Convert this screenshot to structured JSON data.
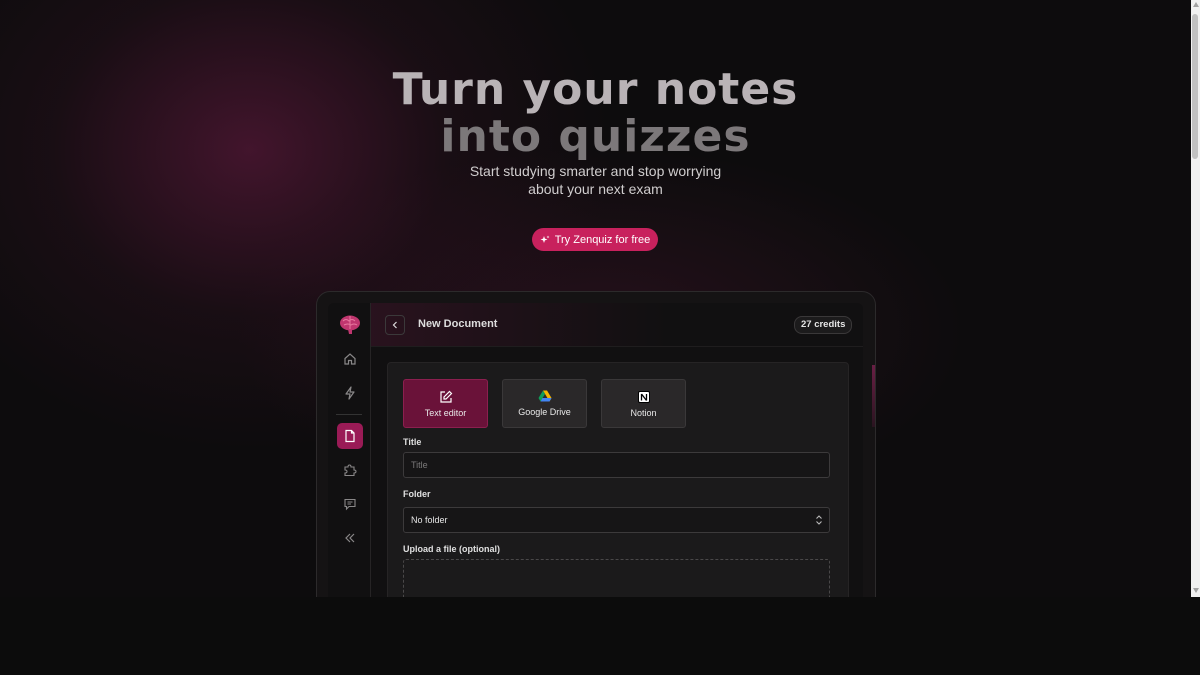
{
  "hero": {
    "title_line1": "Turn your notes",
    "title_line2": "into quizzes",
    "subtitle_line1": "Start studying smarter and stop worrying",
    "subtitle_line2": "about your next exam",
    "cta_label": "Try Zenquiz for free"
  },
  "app": {
    "header": {
      "title": "New Document",
      "credits": "27 credits"
    },
    "sidebar": {
      "items": [
        {
          "icon": "brain-logo-icon"
        },
        {
          "icon": "home-icon"
        },
        {
          "icon": "lightning-icon"
        },
        {
          "icon": "document-icon",
          "active": true
        },
        {
          "icon": "puzzle-icon"
        },
        {
          "icon": "chat-icon"
        },
        {
          "icon": "collapse-icon"
        }
      ]
    },
    "sources": [
      {
        "label": "Text editor",
        "icon": "edit-icon",
        "active": true
      },
      {
        "label": "Google Drive",
        "icon": "google-drive-icon"
      },
      {
        "label": "Notion",
        "icon": "notion-icon"
      }
    ],
    "form": {
      "title_label": "Title",
      "title_placeholder": "Title",
      "folder_label": "Folder",
      "folder_value": "No folder",
      "upload_label": "Upload a file (optional)"
    }
  },
  "colors": {
    "accent": "#c8215d",
    "active_tab": "#6a1239",
    "background": "#0d0c0d"
  }
}
